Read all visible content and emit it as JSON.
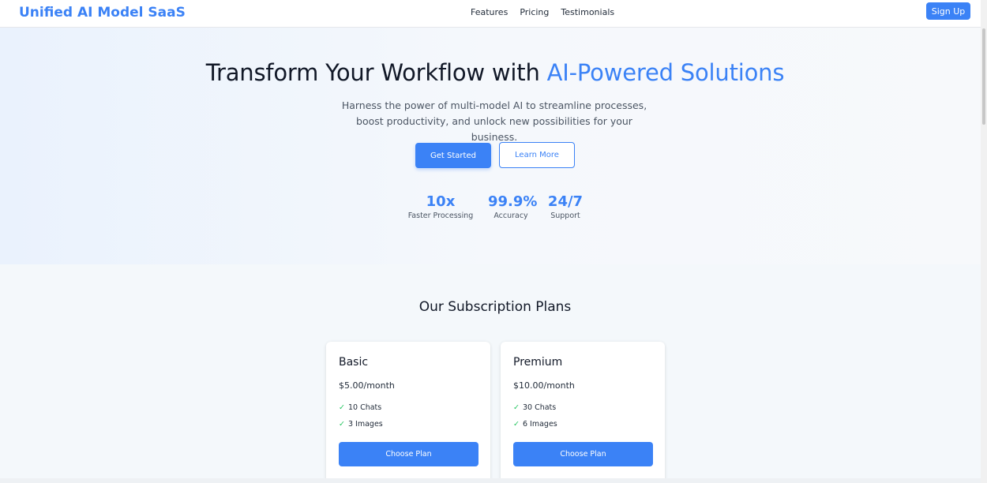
{
  "header": {
    "brand": "Unified AI Model SaaS",
    "nav": [
      "Features",
      "Pricing",
      "Testimonials"
    ],
    "signup_label": "Sign Up"
  },
  "hero": {
    "title_main": "Transform Your Workflow with ",
    "title_accent": "AI-Powered Solutions",
    "subtitle": "Harness the power of multi-model AI to streamline processes, boost productivity, and unlock new possibilities for your business.",
    "primary_cta": "Get Started",
    "secondary_cta": "Learn More",
    "stats": [
      {
        "value": "10x",
        "label": "Faster Processing"
      },
      {
        "value": "99.9%",
        "label": "Accuracy"
      },
      {
        "value": "24/7",
        "label": "Support"
      }
    ]
  },
  "plans": {
    "title": "Our Subscription Plans",
    "items": [
      {
        "name": "Basic",
        "price": "$5.00/month",
        "features": [
          "10 Chats",
          "3 Images"
        ],
        "cta": "Choose Plan"
      },
      {
        "name": "Premium",
        "price": "$10.00/month",
        "features": [
          "30 Chats",
          "6 Images"
        ],
        "cta": "Choose Plan"
      }
    ]
  },
  "icons": {
    "check": "check-icon"
  },
  "colors": {
    "accent": "#3b82f6",
    "check": "#22c55e"
  }
}
